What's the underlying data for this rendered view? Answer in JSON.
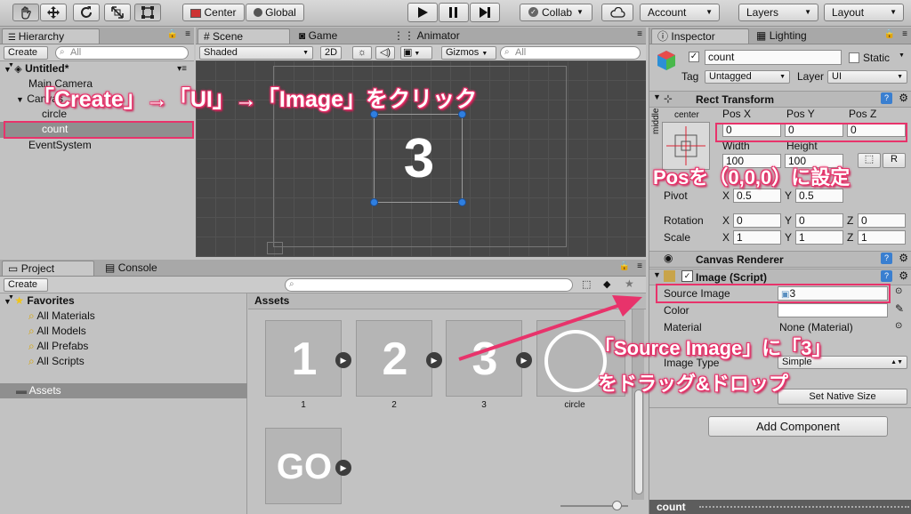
{
  "toolbar": {
    "pivot": "Center",
    "space": "Global",
    "collab": "Collab",
    "account": "Account",
    "layers": "Layers",
    "layout": "Layout"
  },
  "hierarchy": {
    "tab": "Hierarchy",
    "create": "Create",
    "search_placeholder": "All",
    "scene": "Untitled*",
    "items": [
      "Main Camera",
      "Canvas",
      "circle",
      "count",
      "EventSystem"
    ]
  },
  "scene": {
    "tabs": [
      "Scene",
      "Game",
      "Animator"
    ],
    "shading": "Shaded",
    "mode2d": "2D",
    "gizmos": "Gizmos",
    "search_placeholder": "All",
    "preview_number": "3"
  },
  "project": {
    "tabs": [
      "Project",
      "Console"
    ],
    "create": "Create",
    "favorites": "Favorites",
    "fav_items": [
      "All Materials",
      "All Models",
      "All Prefabs",
      "All Scripts"
    ],
    "assets": "Assets",
    "assets_header": "Assets",
    "thumbs": [
      {
        "glyph": "1",
        "caption": "1"
      },
      {
        "glyph": "2",
        "caption": "2"
      },
      {
        "glyph": "3",
        "caption": "3"
      },
      {
        "glyph": "",
        "caption": "circle"
      },
      {
        "glyph": "GO",
        "caption": ""
      }
    ]
  },
  "inspector": {
    "tabs": [
      "Inspector",
      "Lighting"
    ],
    "object_name": "count",
    "static": "Static",
    "tag_label": "Tag",
    "tag_value": "Untagged",
    "layer_label": "Layer",
    "layer_value": "UI",
    "rect_transform": "Rect Transform",
    "anchor_top": "center",
    "anchor_side": "middle",
    "pos_labels": [
      "Pos X",
      "Pos Y",
      "Pos Z"
    ],
    "pos_values": [
      "0",
      "0",
      "0"
    ],
    "width_label": "Width",
    "height_label": "Height",
    "width_value": "100",
    "height_value": "100",
    "r_button": "R",
    "pivot_label": "Pivot",
    "pivot_values": [
      "0.5",
      "0.5"
    ],
    "rotation_label": "Rotation",
    "rotation_values": [
      "0",
      "0",
      "0"
    ],
    "scale_label": "Scale",
    "scale_values": [
      "1",
      "1",
      "1"
    ],
    "axes": [
      "X",
      "Y",
      "Z"
    ],
    "canvas_renderer": "Canvas Renderer",
    "image_script": "Image (Script)",
    "source_image_label": "Source Image",
    "source_image_value": "3",
    "color_label": "Color",
    "material_label": "Material",
    "material_value": "None (Material)",
    "image_type_label": "Image Type",
    "image_type_value": "Simple",
    "native_size": "Set Native Size",
    "add_component": "Add Component",
    "footer": "count"
  },
  "annotations": {
    "create_path": "「Create」→「UI」→「Image」をクリック",
    "pos": "Posを（0,0,0）に設定",
    "source_line1": "「Source Image」に「3」",
    "source_line2": "をドラッグ&ドロップ"
  },
  "colors": {
    "highlight": "#e8336b",
    "scene_bg": "#474747"
  }
}
